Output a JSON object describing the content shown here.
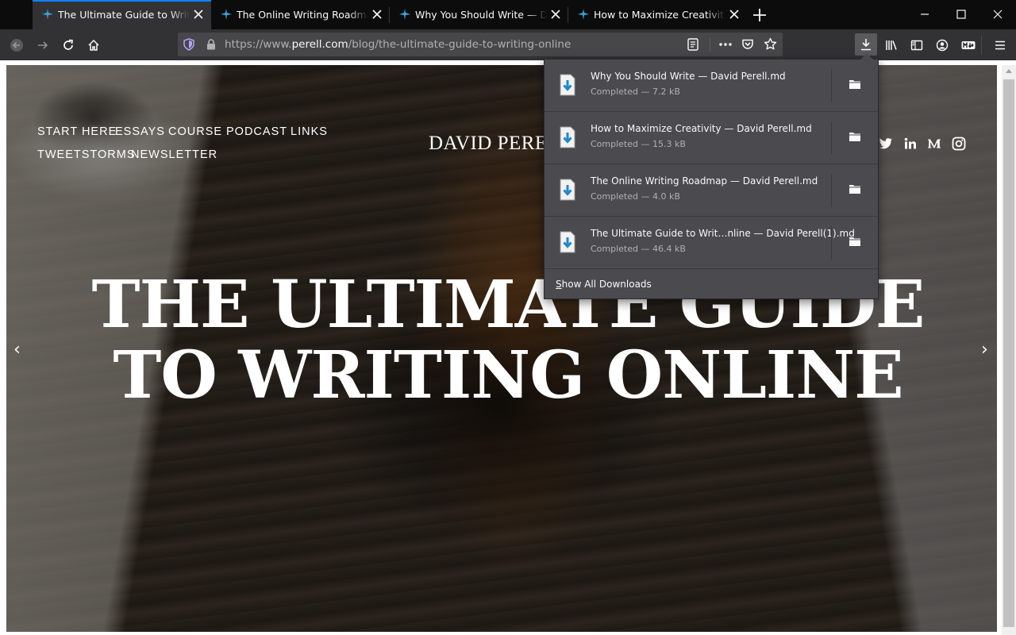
{
  "tabs": [
    {
      "title": "The Ultimate Guide to Writing Online — David Perell",
      "active": true
    },
    {
      "title": "The Online Writing Roadmap — David Perell",
      "active": false
    },
    {
      "title": "Why You Should Write — David Perell",
      "active": false
    },
    {
      "title": "How to Maximize Creativity — David Perell",
      "active": false
    }
  ],
  "address_bar": {
    "url_prefix": "https://www.",
    "url_host": "perell.com",
    "url_path": "/blog/the-ultimate-guide-to-writing-online"
  },
  "site": {
    "nav_row1": [
      "START HERE",
      "ESSAYS",
      "COURSE",
      "PODCAST",
      "LINKS"
    ],
    "nav_row2": [
      "TWEETSTORMS",
      "NEWSLETTER"
    ],
    "brand": "DAVID PERELL",
    "headline_line1": "THE ULTIMATE GUIDE",
    "headline_line2": "TO WRITING ONLINE",
    "prev_arrow": "‹",
    "next_arrow": "›"
  },
  "downloads": {
    "items": [
      {
        "name": "Why You Should Write — David Perell.md",
        "status": "Completed — 7.2 kB"
      },
      {
        "name": "How to Maximize Creativity — David Perell.md",
        "status": "Completed — 15.3 kB"
      },
      {
        "name": "The Online Writing Roadmap — David Perell.md",
        "status": "Completed — 4.0 kB"
      },
      {
        "name": "The Ultimate Guide to Writ…nline — David Perell(1).md",
        "status": "Completed — 46.4 kB"
      }
    ],
    "show_all_label": "Show All Downloads"
  },
  "colors": {
    "accent": "#0a84ff",
    "toolbar": "#323234",
    "tabstrip": "#0c0c0d",
    "panel": "#4a4a4f",
    "download_arrow": "#1e88c9"
  }
}
